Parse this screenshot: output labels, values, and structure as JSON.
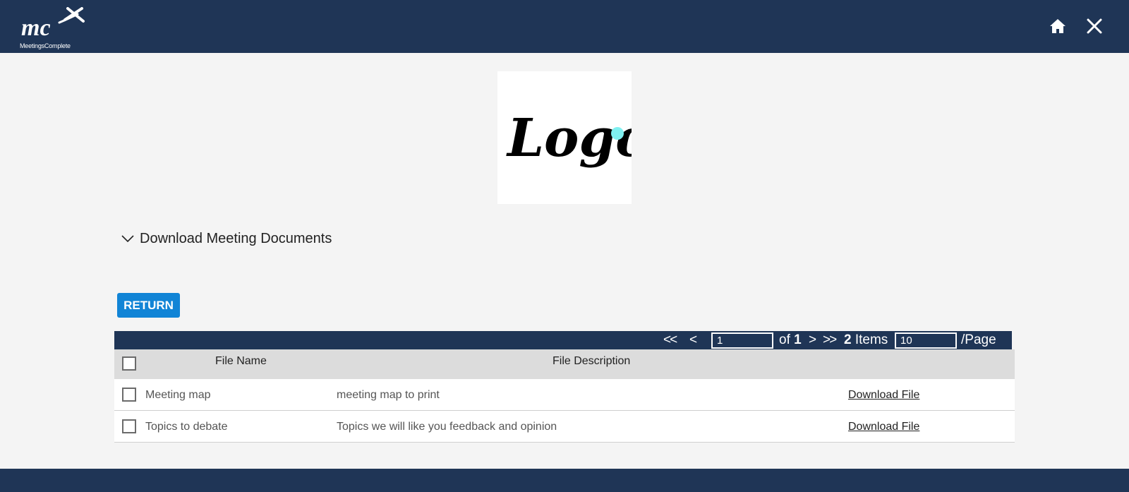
{
  "header": {
    "brand_text": "MeetingsComplete",
    "home_icon": "home-icon",
    "close_icon": "close-icon",
    "background": "#1f3556"
  },
  "logo": {
    "text": "Logo"
  },
  "section": {
    "title": "Download Meeting Documents",
    "icon": "chevron-down-icon"
  },
  "return_button": {
    "label": "RETURN",
    "color": "#1184d6"
  },
  "pager": {
    "first": "<<",
    "prev": "<",
    "page_value": "1",
    "of_label": "of",
    "total_pages": "1",
    "next": ">",
    "last": ">>",
    "item_count": "2",
    "items_label": "Items",
    "page_size_value": "10",
    "per_page_label": "/Page"
  },
  "table": {
    "columns": [
      "File Name",
      "File Description"
    ],
    "rows": [
      {
        "name": "Meeting map",
        "description": "meeting map to print",
        "link": "Download File"
      },
      {
        "name": "Topics to debate",
        "description": "Topics we will like you feedback and opinion",
        "link": "Download File"
      }
    ]
  }
}
